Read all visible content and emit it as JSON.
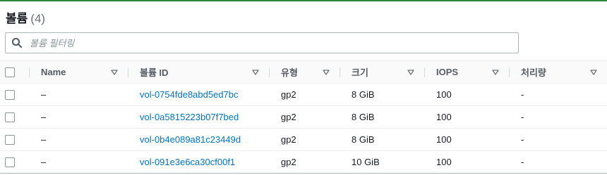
{
  "header": {
    "title": "볼륨",
    "count": "(4)"
  },
  "search": {
    "placeholder": "볼륨 필터링",
    "value": ""
  },
  "table": {
    "columns": [
      {
        "label": "Name"
      },
      {
        "label": "볼륨 ID"
      },
      {
        "label": "유형"
      },
      {
        "label": "크기"
      },
      {
        "label": "IOPS"
      },
      {
        "label": "처리량"
      }
    ],
    "rows": [
      {
        "name": "–",
        "volume_id": "vol-0754fde8abd5ed7bc",
        "type": "gp2",
        "size": "8 GiB",
        "iops": "100",
        "throughput": "-"
      },
      {
        "name": "–",
        "volume_id": "vol-0a5815223b07f7bed",
        "type": "gp2",
        "size": "8 GiB",
        "iops": "100",
        "throughput": "-"
      },
      {
        "name": "–",
        "volume_id": "vol-0b4e089a81c23449d",
        "type": "gp2",
        "size": "8 GiB",
        "iops": "100",
        "throughput": "-"
      },
      {
        "name": "–",
        "volume_id": "vol-091e3e6ca30cf00f1",
        "type": "gp2",
        "size": "10 GiB",
        "iops": "100",
        "throughput": "-"
      }
    ]
  },
  "colors": {
    "accent": "#2e8540",
    "link": "#0073bb",
    "header_bg": "#fafafa",
    "border": "#eaeded"
  },
  "icons": {
    "search": "search-icon",
    "sort": "caret-down-outline-icon"
  }
}
